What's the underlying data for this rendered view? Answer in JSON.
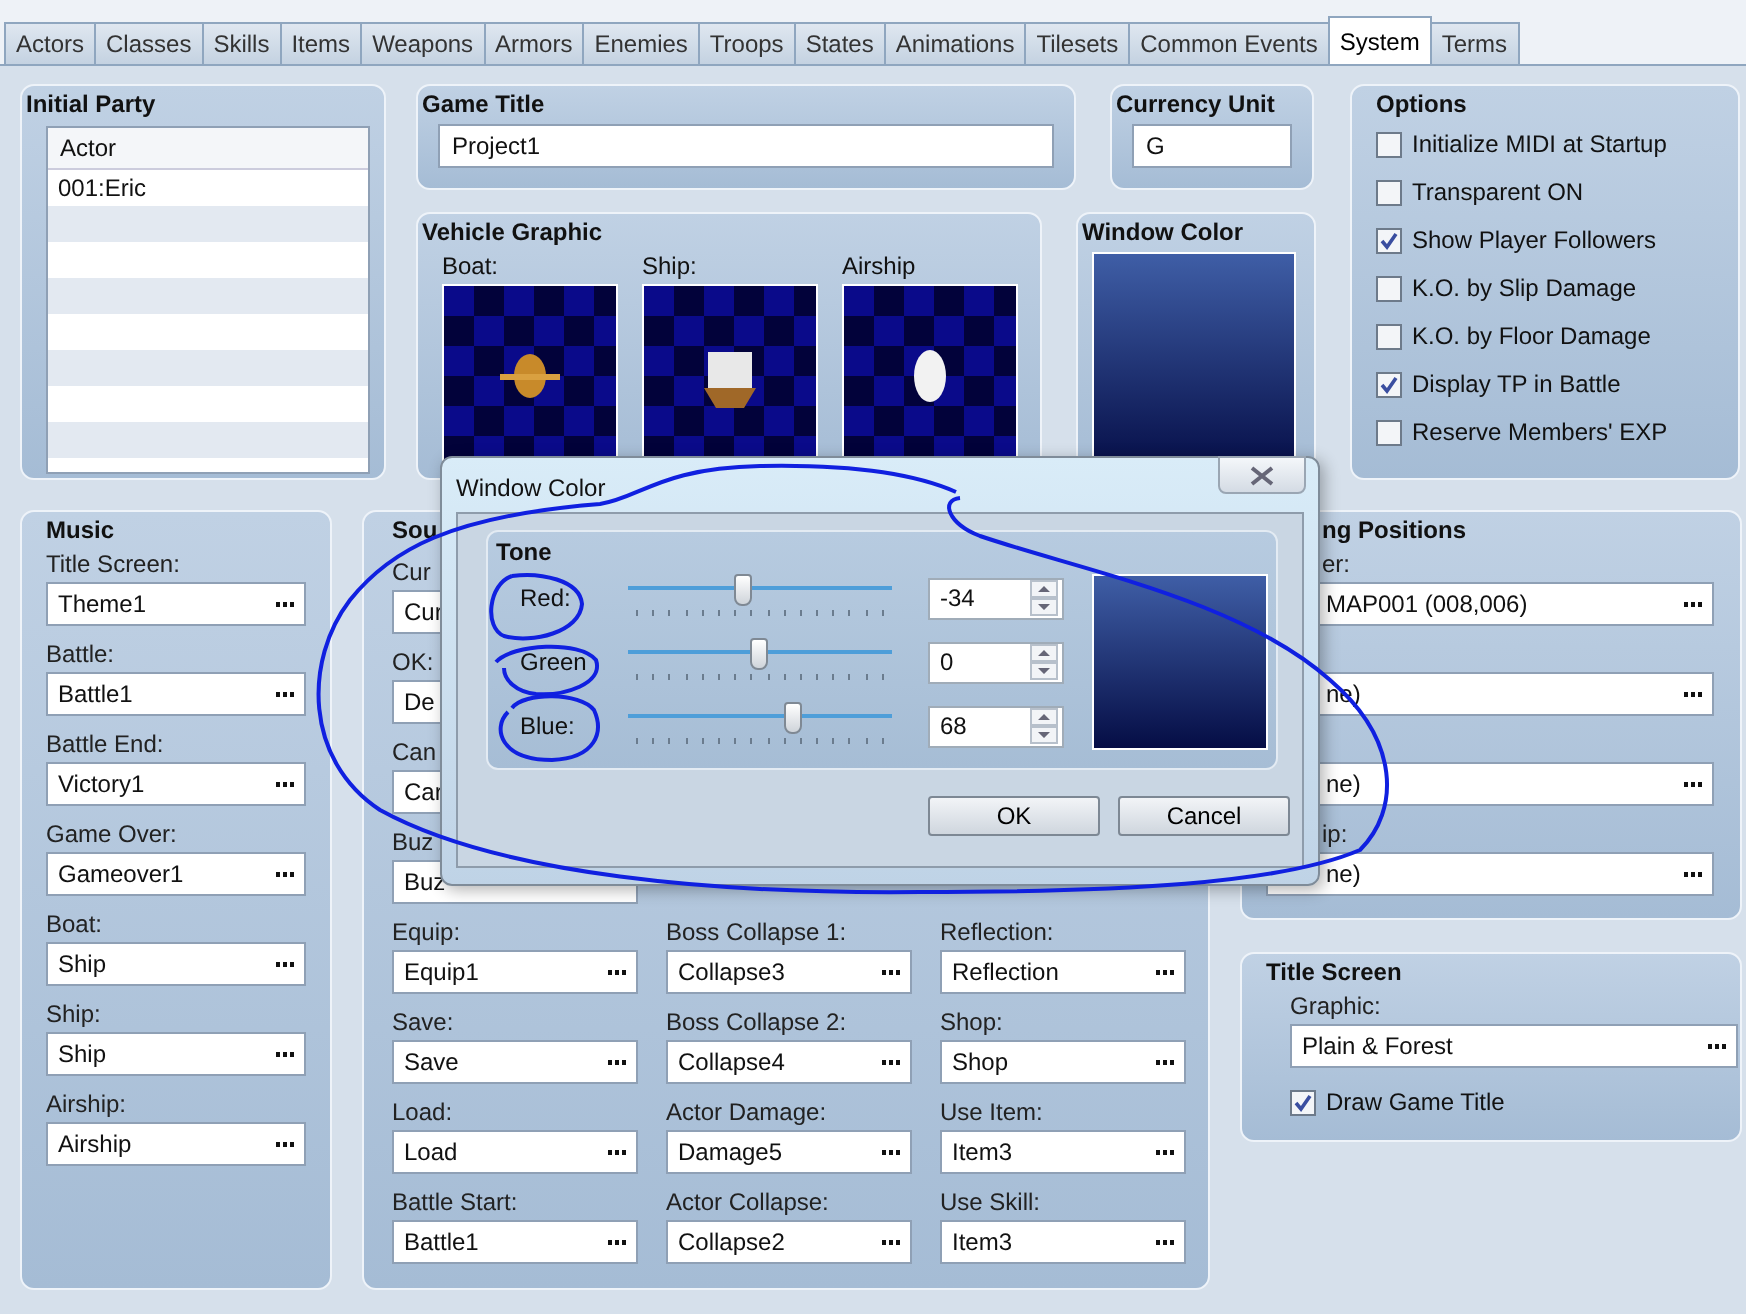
{
  "tabs": [
    {
      "label": "Actors",
      "selected": false
    },
    {
      "label": "Classes",
      "selected": false
    },
    {
      "label": "Skills",
      "selected": false
    },
    {
      "label": "Items",
      "selected": false
    },
    {
      "label": "Weapons",
      "selected": false
    },
    {
      "label": "Armors",
      "selected": false
    },
    {
      "label": "Enemies",
      "selected": false
    },
    {
      "label": "Troops",
      "selected": false
    },
    {
      "label": "States",
      "selected": false
    },
    {
      "label": "Animations",
      "selected": false
    },
    {
      "label": "Tilesets",
      "selected": false
    },
    {
      "label": "Common Events",
      "selected": false
    },
    {
      "label": "System",
      "selected": true
    },
    {
      "label": "Terms",
      "selected": false
    }
  ],
  "initial_party": {
    "title": "Initial Party",
    "column": "Actor",
    "rows": [
      "001:Eric"
    ]
  },
  "game_title": {
    "title": "Game Title",
    "value": "Project1"
  },
  "currency_unit": {
    "title": "Currency Unit",
    "value": "G"
  },
  "vehicle_graphic": {
    "title": "Vehicle Graphic",
    "vehicles": [
      {
        "label": "Boat:"
      },
      {
        "label": "Ship:"
      },
      {
        "label": "Airship"
      }
    ]
  },
  "window_color": {
    "title": "Window Color"
  },
  "options": {
    "title": "Options",
    "items": [
      {
        "label": "Initialize MIDI at Startup",
        "checked": false
      },
      {
        "label": "Transparent ON",
        "checked": false
      },
      {
        "label": "Show Player Followers",
        "checked": true
      },
      {
        "label": "K.O. by Slip Damage",
        "checked": false
      },
      {
        "label": "K.O. by Floor Damage",
        "checked": false
      },
      {
        "label": "Display TP in Battle",
        "checked": true
      },
      {
        "label": "Reserve Members' EXP",
        "checked": false
      }
    ]
  },
  "music": {
    "title": "Music",
    "fields": [
      {
        "label": "Title Screen:",
        "value": "Theme1"
      },
      {
        "label": "Battle:",
        "value": "Battle1"
      },
      {
        "label": "Battle End:",
        "value": "Victory1"
      },
      {
        "label": "Game Over:",
        "value": "Gameover1"
      },
      {
        "label": "Boat:",
        "value": "Ship"
      },
      {
        "label": "Ship:",
        "value": "Ship"
      },
      {
        "label": "Airship:",
        "value": "Airship"
      }
    ]
  },
  "sound": {
    "title": "Sou",
    "columns": [
      [
        {
          "label": "Cur",
          "value": "Cur"
        },
        {
          "label": "OK:",
          "value": "De"
        },
        {
          "label": "Can",
          "value": "Car"
        },
        {
          "label": "Buz",
          "value": "Buz"
        },
        {
          "label": "Equip:",
          "value": "Equip1"
        },
        {
          "label": "Save:",
          "value": "Save"
        },
        {
          "label": "Load:",
          "value": "Load"
        },
        {
          "label": "Battle Start:",
          "value": "Battle1"
        }
      ],
      [
        {
          "label": "Boss Collapse 1:",
          "value": "Collapse3"
        },
        {
          "label": "Boss Collapse 2:",
          "value": "Collapse4"
        },
        {
          "label": "Actor Damage:",
          "value": "Damage5"
        },
        {
          "label": "Actor Collapse:",
          "value": "Collapse2"
        }
      ],
      [
        {
          "label": "Reflection:",
          "value": "Reflection"
        },
        {
          "label": "Shop:",
          "value": "Shop"
        },
        {
          "label": "Use Item:",
          "value": "Item3"
        },
        {
          "label": "Use Skill:",
          "value": "Item3"
        }
      ]
    ]
  },
  "starting_positions": {
    "title": "ng Positions",
    "fields": [
      {
        "label": "er:",
        "value": "MAP001 (008,006)"
      },
      {
        "value": "ne)"
      },
      {
        "value": "ne)"
      },
      {
        "label": "ip:",
        "value": "ne)"
      }
    ]
  },
  "title_screen": {
    "title": "Title Screen",
    "label": "Graphic:",
    "value": "Plain & Forest",
    "checkbox": {
      "label": "Draw Game Title",
      "checked": true
    }
  },
  "dialog": {
    "title": "Window Color",
    "group": "Tone",
    "channels": [
      {
        "name": "Red:",
        "level": 0.44,
        "value": "-34"
      },
      {
        "name": "Green",
        "level": 0.5,
        "value": "0"
      },
      {
        "name": "Blue:",
        "level": 0.63,
        "value": "68"
      }
    ],
    "buttons": [
      "OK",
      "Cancel"
    ]
  }
}
